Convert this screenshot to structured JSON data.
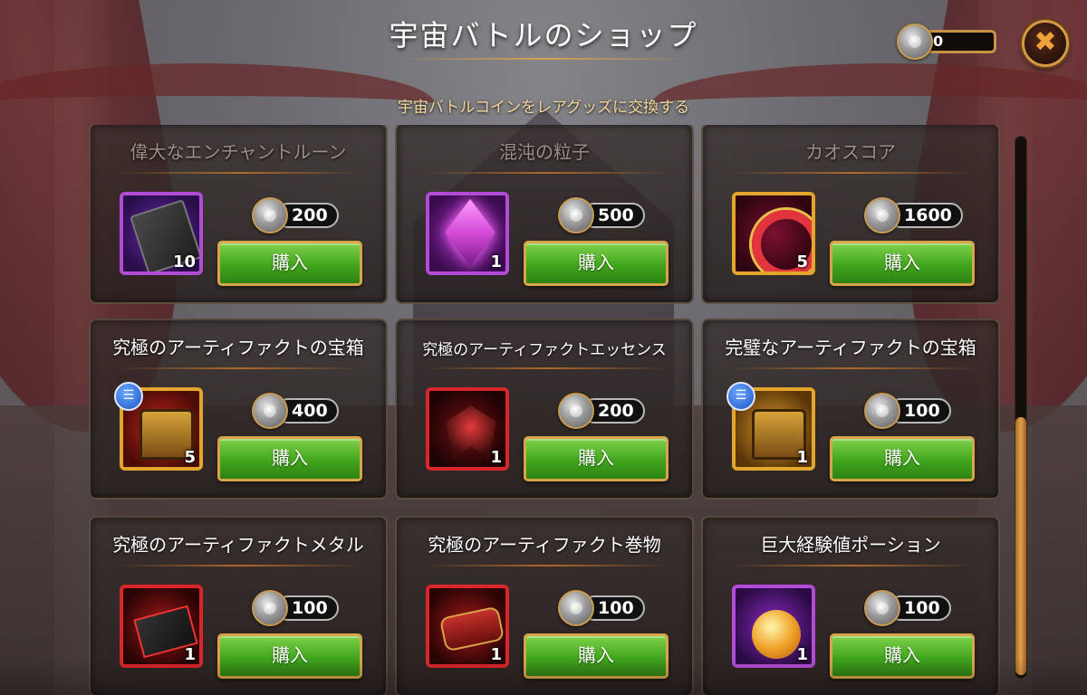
{
  "header": {
    "title": "宇宙バトルのショップ",
    "subtitle": "宇宙バトルコインをレアグッズに交換する",
    "coin_balance": "0",
    "close_label": "✖"
  },
  "shop": {
    "buy_label": "購入",
    "items": [
      {
        "name": "偉大なエンチャントルーン",
        "price": "200",
        "quantity": "10",
        "rarity_color": "#b24bd6",
        "icon": "enchant-rune-icon"
      },
      {
        "name": "混沌の粒子",
        "price": "500",
        "quantity": "1",
        "rarity_color": "#b24bd6",
        "icon": "chaos-particle-icon"
      },
      {
        "name": "カオスコア",
        "price": "1600",
        "quantity": "5",
        "rarity_color": "#e3a52b",
        "icon": "chaos-core-icon"
      },
      {
        "name": "究極のアーティファクトの宝箱",
        "price": "400",
        "quantity": "5",
        "rarity_color": "#e3a52b",
        "icon": "artifact-chest-icon"
      },
      {
        "name": "究極のアーティファクトエッセンス",
        "price": "200",
        "quantity": "1",
        "rarity_color": "#d8262b",
        "icon": "artifact-essence-icon"
      },
      {
        "name": "完璧なアーティファクトの宝箱",
        "price": "100",
        "quantity": "1",
        "rarity_color": "#e3a52b",
        "icon": "perfect-chest-icon"
      },
      {
        "name": "究極のアーティファクトメタル",
        "price": "100",
        "quantity": "1",
        "rarity_color": "#d8262b",
        "icon": "artifact-metal-icon"
      },
      {
        "name": "究極のアーティファクト巻物",
        "price": "100",
        "quantity": "1",
        "rarity_color": "#d8262b",
        "icon": "artifact-scroll-icon"
      },
      {
        "name": "巨大経験値ポーション",
        "price": "100",
        "quantity": "1",
        "rarity_color": "#b24bd6",
        "icon": "xp-potion-icon"
      }
    ]
  },
  "colors": {
    "buy_button": "#41a51e",
    "accent_gold": "#d49a45",
    "subtitle_text": "#f4d79a"
  }
}
